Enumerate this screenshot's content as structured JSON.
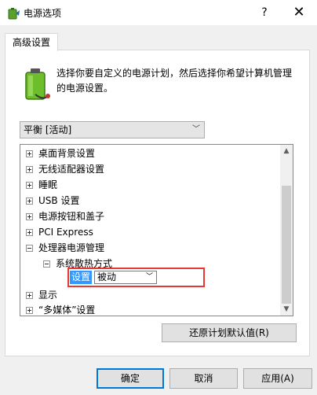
{
  "window": {
    "title": "电源选项",
    "help": "?",
    "close": "✕"
  },
  "tab": {
    "label": "高级设置"
  },
  "description": "选择你要自定义的电源计划，然后选择你希望计算机管理的电源设置。",
  "plan_select": {
    "value": "平衡 [活动]"
  },
  "tree": {
    "items": [
      {
        "label": "桌面背景设置",
        "state": "collapsed"
      },
      {
        "label": "无线适配器设置",
        "state": "collapsed"
      },
      {
        "label": "睡眠",
        "state": "collapsed"
      },
      {
        "label": "USB 设置",
        "state": "collapsed"
      },
      {
        "label": "电源按钮和盖子",
        "state": "collapsed"
      },
      {
        "label": "PCI Express",
        "state": "collapsed"
      },
      {
        "label": "处理器电源管理",
        "state": "expanded"
      },
      {
        "label": "系统散热方式",
        "state": "expanded"
      },
      {
        "label": "显示",
        "state": "collapsed"
      },
      {
        "label": "“多媒体”设置",
        "state": "collapsed"
      }
    ],
    "setting_label": "设置",
    "setting_value": "被动"
  },
  "restore_button": "还原计划默认值(R)",
  "buttons": {
    "ok": "确定",
    "cancel": "取消",
    "apply": "应用(A)"
  },
  "colors": {
    "highlight": "#3399ff",
    "annotation": "#e53935",
    "default_button_border": "#0078d7"
  }
}
